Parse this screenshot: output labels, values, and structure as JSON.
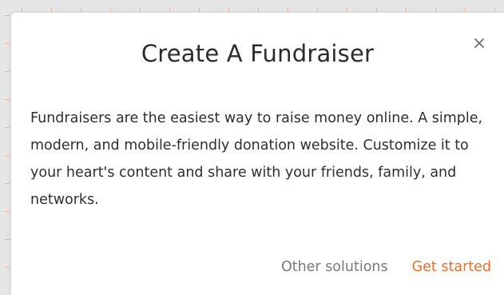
{
  "modal": {
    "title": "Create A Fundraiser",
    "body": "Fundraisers are the easiest way to raise money online. A simple, modern, and mobile-friendly donation website. Customize it to your heart's content and share with your friends, family, and networks.",
    "close_icon": "close-icon",
    "secondary_button_label": "Other solutions",
    "primary_button_label": "Get started"
  },
  "colors": {
    "accent": "#f06d2b",
    "secondary_text": "#7a7a7a",
    "body_text": "#2e2e2e",
    "background": "#ffffff"
  }
}
